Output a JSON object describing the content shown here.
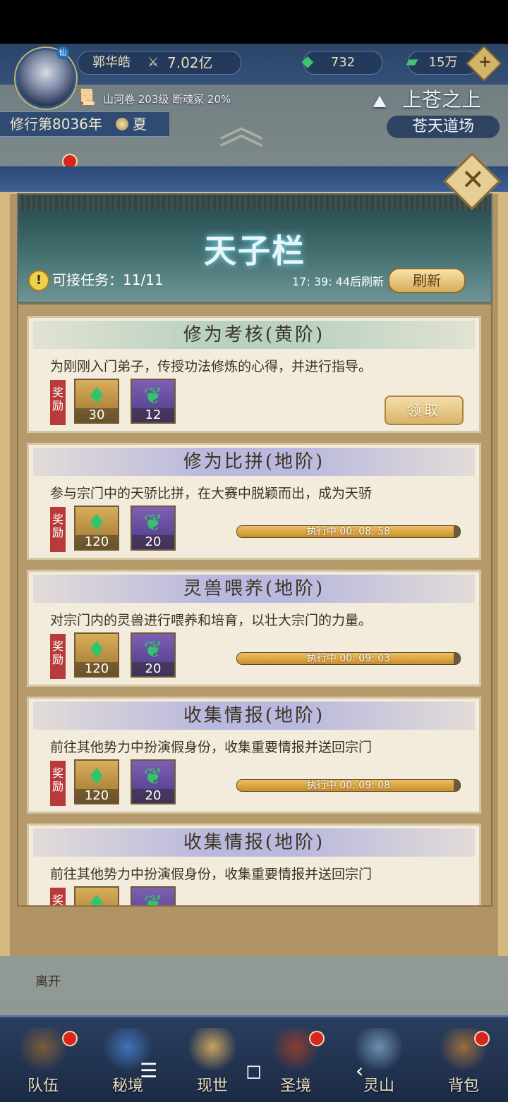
{
  "hud": {
    "player_name": "郭华皓",
    "power": "7.02亿",
    "currency_1": "732",
    "currency_2": "15万",
    "location": "山河卷 203级 断魂冢 20%",
    "year": "修行第8036年",
    "season": "夏",
    "realm_title": "上苍之上",
    "realm_sub": "苍天道场",
    "avatar_badge": "仙"
  },
  "panel": {
    "title": "天子栏",
    "task_count_label": "可接任务：11/11",
    "refresh_time": "17: 39: 44后刷新",
    "refresh_button": "刷新",
    "reward_label": "奖励",
    "tasks": [
      {
        "title": "修为考核(黄阶)",
        "desc": "为刚刚入门弟子，传授功法修炼的心得，并进行指导。",
        "reward_1": "30",
        "reward_2": "12",
        "status": "claim",
        "claim_label": "领取"
      },
      {
        "title": "修为比拼(地阶)",
        "desc": "参与宗门中的天骄比拼，在大赛中脱颖而出，成为天骄",
        "reward_1": "120",
        "reward_2": "20",
        "status": "running",
        "progress_text": "执行中 00: 08: 58",
        "progress": 0.97
      },
      {
        "title": "灵兽喂养(地阶)",
        "desc": "对宗门内的灵兽进行喂养和培育，以壮大宗门的力量。",
        "reward_1": "120",
        "reward_2": "20",
        "status": "running",
        "progress_text": "执行中 00: 09: 03",
        "progress": 0.97
      },
      {
        "title": "收集情报(地阶)",
        "desc": "前往其他势力中扮演假身份，收集重要情报并送回宗门",
        "reward_1": "120",
        "reward_2": "20",
        "status": "running",
        "progress_text": "执行中 00: 09: 08",
        "progress": 0.97
      },
      {
        "title": "收集情报(地阶)",
        "desc": "前往其他势力中扮演假身份，收集重要情报并送回宗门",
        "reward_1": "",
        "reward_2": "",
        "status": "partial"
      }
    ]
  },
  "leave_label": "离开",
  "nav": [
    {
      "label": "队伍",
      "color": "#7a5b3a"
    },
    {
      "label": "秘境",
      "color": "#3f74b8"
    },
    {
      "label": "现世",
      "color": "#c9a25e"
    },
    {
      "label": "圣境",
      "color": "#8a3c2e"
    },
    {
      "label": "灵山",
      "color": "#6d8fb0"
    },
    {
      "label": "背包",
      "color": "#9a6b3c"
    }
  ],
  "system_nav": {
    "menu": "☰",
    "home": "◻",
    "back": "‹"
  }
}
